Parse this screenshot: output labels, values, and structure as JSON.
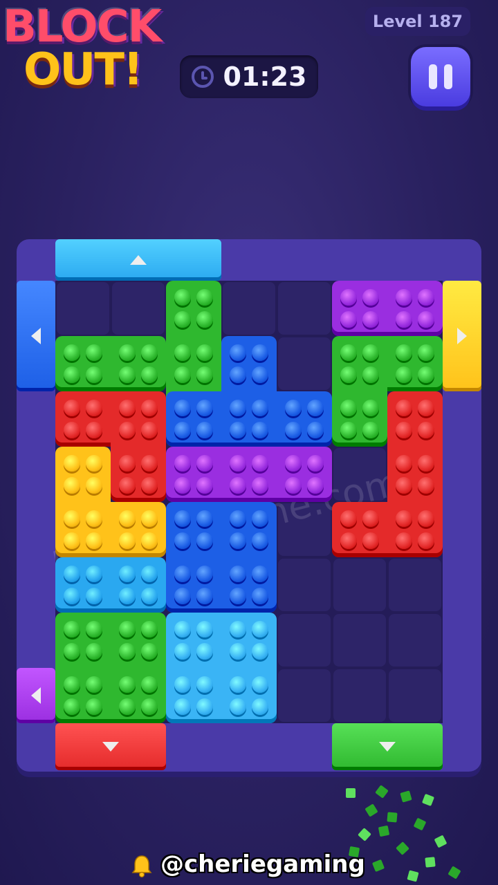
{
  "header": {
    "logo_line1": "BLOCK",
    "logo_line2": "OUT!",
    "timer": "01:23",
    "level": "Level 187"
  },
  "colors": {
    "green": "#2fb82f",
    "red": "#e42a2a",
    "blue": "#1d5fe6",
    "purple": "#9a2ee0",
    "yellow": "#ffc21a",
    "cyan": "#2aa8f0",
    "lightblue": "#3ab4f5"
  },
  "board": {
    "cols": 7,
    "rows": 8,
    "pieces": [
      {
        "color": "green",
        "cells": [
          [
            2,
            0
          ],
          [
            2,
            1
          ],
          [
            2,
            2
          ]
        ]
      },
      {
        "color": "purple",
        "cells": [
          [
            5,
            0
          ],
          [
            6,
            0
          ]
        ]
      },
      {
        "color": "green",
        "cells": [
          [
            0,
            1
          ],
          [
            1,
            1
          ]
        ]
      },
      {
        "color": "blue",
        "cells": [
          [
            3,
            1
          ],
          [
            3,
            2
          ],
          [
            2,
            2
          ],
          [
            4,
            2
          ]
        ]
      },
      {
        "color": "green",
        "cells": [
          [
            5,
            1
          ],
          [
            6,
            1
          ],
          [
            5,
            2
          ]
        ]
      },
      {
        "color": "red",
        "cells": [
          [
            0,
            2
          ],
          [
            1,
            2
          ],
          [
            1,
            3
          ]
        ]
      },
      {
        "color": "red",
        "cells": [
          [
            6,
            2
          ],
          [
            6,
            3
          ],
          [
            6,
            4
          ],
          [
            5,
            4
          ]
        ]
      },
      {
        "color": "purple",
        "cells": [
          [
            2,
            3
          ],
          [
            3,
            3
          ],
          [
            4,
            3
          ]
        ]
      },
      {
        "color": "yellow",
        "cells": [
          [
            0,
            3
          ],
          [
            0,
            4
          ],
          [
            1,
            4
          ]
        ]
      },
      {
        "color": "blue",
        "cells": [
          [
            2,
            4
          ],
          [
            3,
            4
          ],
          [
            2,
            5
          ],
          [
            3,
            5
          ]
        ]
      },
      {
        "color": "cyan",
        "cells": [
          [
            0,
            5
          ],
          [
            1,
            5
          ]
        ]
      },
      {
        "color": "green",
        "cells": [
          [
            0,
            6
          ],
          [
            1,
            6
          ],
          [
            0,
            7
          ],
          [
            1,
            7
          ]
        ]
      },
      {
        "color": "lightblue",
        "cells": [
          [
            2,
            6
          ],
          [
            3,
            6
          ],
          [
            2,
            7
          ],
          [
            3,
            7
          ]
        ]
      }
    ],
    "gates": [
      {
        "name": "top-blue-gate",
        "color": "cyan",
        "dir": "up"
      },
      {
        "name": "left-blue-gate",
        "color": "blue",
        "dir": "left"
      },
      {
        "name": "right-yellow-gate",
        "color": "yellow",
        "dir": "right"
      },
      {
        "name": "left-purple-gate",
        "color": "purple",
        "dir": "left"
      },
      {
        "name": "bottom-red-gate",
        "color": "red",
        "dir": "down"
      },
      {
        "name": "bottom-green-gate",
        "color": "green",
        "dir": "down"
      }
    ]
  },
  "watermark": "blockoutgame.com",
  "footer": {
    "handle": "@cheriegaming"
  }
}
